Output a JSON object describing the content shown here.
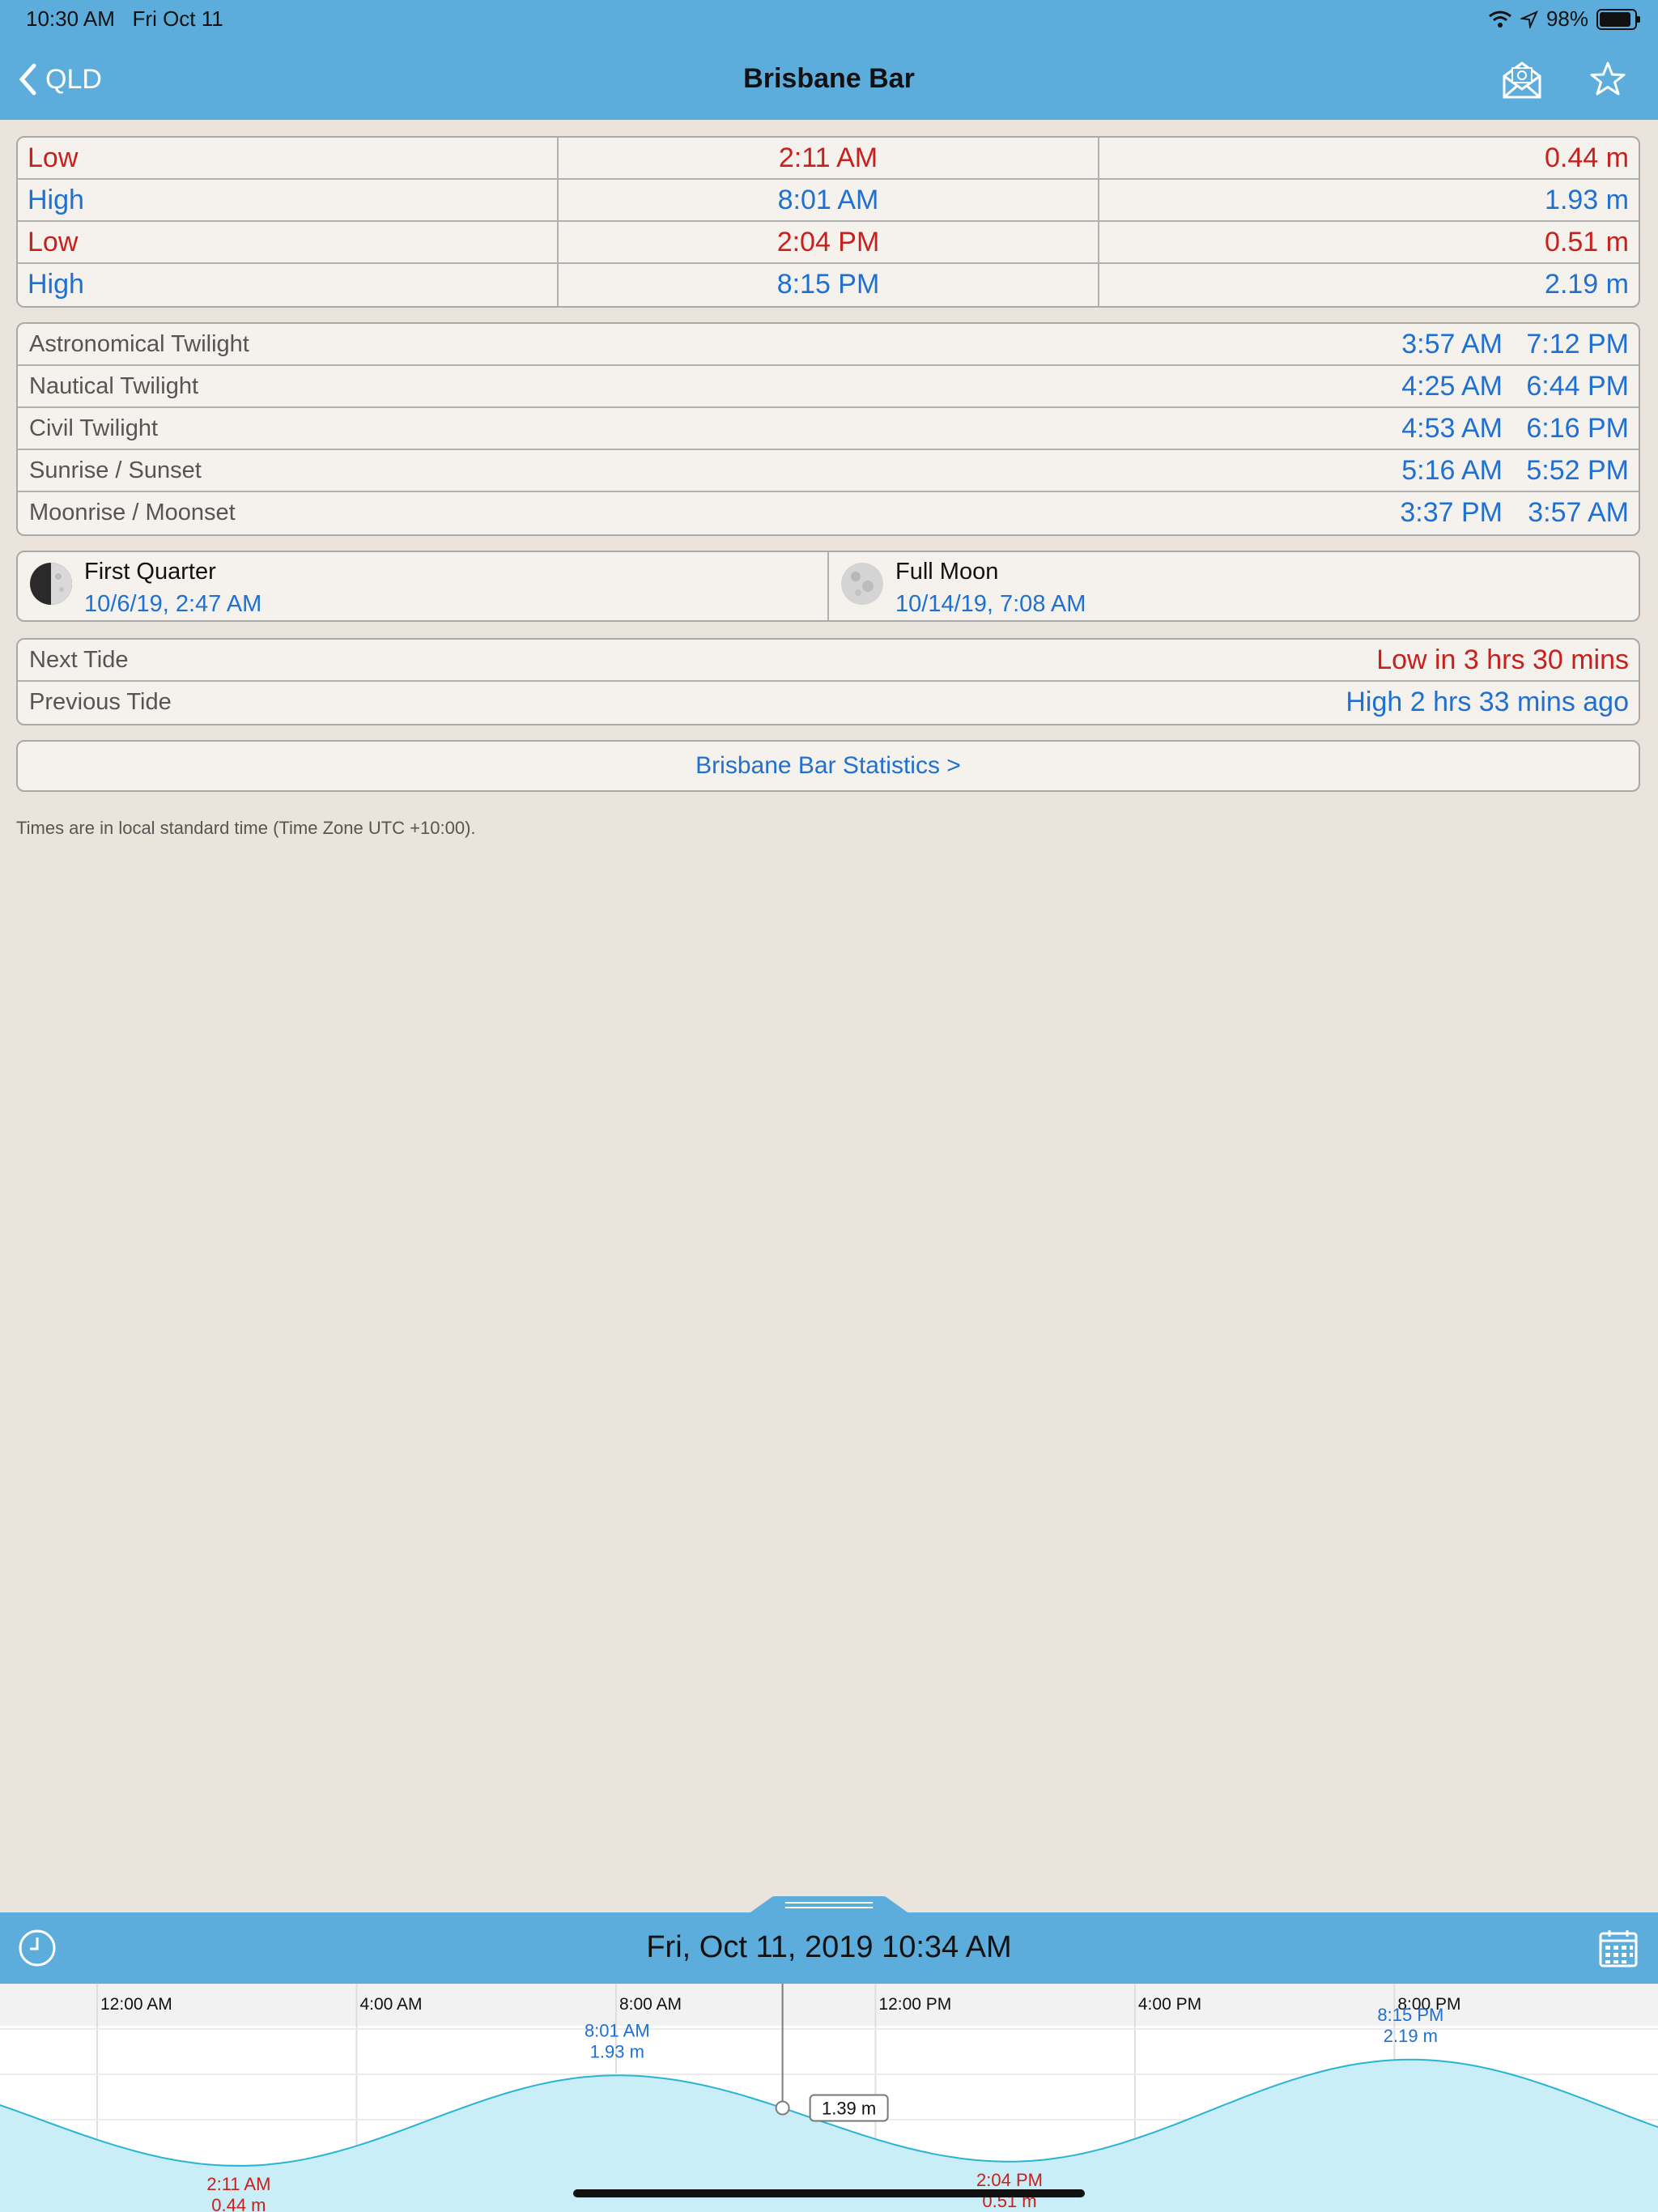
{
  "status": {
    "time": "10:30 AM",
    "date": "Fri Oct 11",
    "battery": "98%"
  },
  "nav": {
    "back_label": "QLD",
    "title": "Brisbane Bar",
    "mail_icon": "mail-icon",
    "favorite_icon": "star-icon"
  },
  "tides": [
    {
      "type": "Low",
      "time": "2:11 AM",
      "height": "0.44 m"
    },
    {
      "type": "High",
      "time": "8:01 AM",
      "height": "1.93 m"
    },
    {
      "type": "Low",
      "time": "2:04 PM",
      "height": "0.51 m"
    },
    {
      "type": "High",
      "time": "8:15 PM",
      "height": "2.19 m"
    }
  ],
  "sun_moon": [
    {
      "label": "Astronomical Twilight",
      "a": "3:57 AM",
      "b": "7:12 PM"
    },
    {
      "label": "Nautical Twilight",
      "a": "4:25 AM",
      "b": "6:44 PM"
    },
    {
      "label": "Civil Twilight",
      "a": "4:53 AM",
      "b": "6:16 PM"
    },
    {
      "label": "Sunrise / Sunset",
      "a": "5:16 AM",
      "b": "5:52 PM"
    },
    {
      "label": "Moonrise / Moonset",
      "a": "3:37 PM",
      "b": "3:57 AM"
    }
  ],
  "moon_phases": [
    {
      "name": "First Quarter",
      "date": "10/6/19, 2:47 AM"
    },
    {
      "name": "Full Moon",
      "date": "10/14/19, 7:08 AM"
    }
  ],
  "next_tide": {
    "label": "Next Tide",
    "value": "Low in 3 hrs 30 mins"
  },
  "previous_tide": {
    "label": "Previous Tide",
    "value": "High 2 hrs 33 mins ago"
  },
  "stats_button": "Brisbane Bar Statistics >",
  "timezone_note": "Times are in local standard time (Time Zone UTC +10:00).",
  "graph": {
    "date_label": "Fri, Oct 11, 2019 10:34 AM",
    "time_axis": [
      "12:00 AM",
      "4:00 AM",
      "8:00 AM",
      "12:00 PM",
      "4:00 PM",
      "8:00 PM"
    ],
    "current_height": "1.39 m",
    "current_time_hours": 10.567,
    "tide_points": [
      {
        "time": "2:11 AM",
        "height": "0.44 m",
        "hours": 2.183,
        "value": 0.44,
        "kind": "low"
      },
      {
        "time": "8:01 AM",
        "height": "1.93 m",
        "hours": 8.017,
        "value": 1.93,
        "kind": "high"
      },
      {
        "time": "2:04 PM",
        "height": "0.51 m",
        "hours": 14.067,
        "value": 0.51,
        "kind": "low"
      },
      {
        "time": "8:15 PM",
        "height": "2.19 m",
        "hours": 20.25,
        "value": 2.19,
        "kind": "high"
      }
    ],
    "colors": {
      "water_fill": "#c9eef7",
      "water_line": "#29b3d4",
      "low": "#c8201c",
      "high": "#1f70d0"
    }
  }
}
